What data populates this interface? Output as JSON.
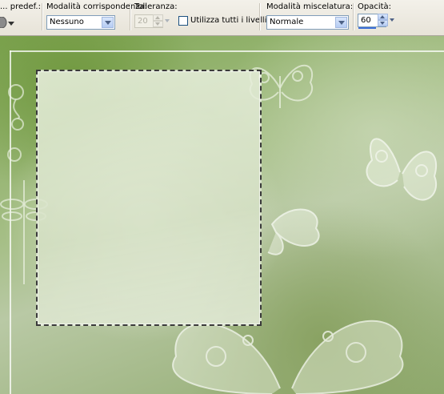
{
  "toolbar": {
    "preset_label": "... predef.:",
    "match_mode": {
      "label": "Modalità corrispondenza:",
      "value": "Nessuno"
    },
    "tolerance": {
      "label": "Tolleranza:",
      "value": "20"
    },
    "all_layers_label": "Utilizza tutti i livelli",
    "blend_mode": {
      "label": "Modalità miscelatura:",
      "value": "Normale"
    },
    "opacity": {
      "label": "Opacità:",
      "value": "60",
      "progress": 0.6
    }
  },
  "colors": {
    "accent": "#3c6fd8",
    "canvas_green": "#8aa866",
    "selection_border": "#3a3a3a"
  },
  "icons": [
    "preset-brush-icon",
    "chevron-down-icon",
    "butterfly-ornament",
    "dragonfly-ornament",
    "flower-ornament"
  ]
}
